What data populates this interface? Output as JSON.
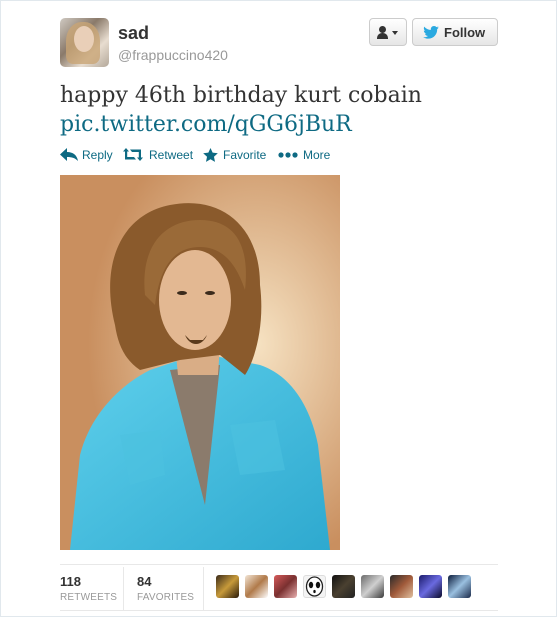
{
  "user": {
    "fullname": "sad",
    "username": "@frappuccino420"
  },
  "buttons": {
    "follow_label": "Follow",
    "user_dropdown_icon": "user-icon"
  },
  "tweet": {
    "text_line1": "happy 46th birthday kurt cobain",
    "link": "pic.twitter.com/qGG6jBuR"
  },
  "actions": [
    {
      "id": "reply",
      "label": "Reply",
      "icon": "reply-icon"
    },
    {
      "id": "retweet",
      "label": "Retweet",
      "icon": "retweet-icon"
    },
    {
      "id": "favorite",
      "label": "Favorite",
      "icon": "star-icon"
    },
    {
      "id": "more",
      "label": "More",
      "icon": "dots-icon"
    }
  ],
  "stats": {
    "retweets_count": "118",
    "retweets_label": "RETWEETS",
    "favorites_count": "84",
    "favorites_label": "FAVORITES"
  },
  "colors": {
    "link": "#0e6a83",
    "twitter_blue": "#2aa9e0"
  }
}
